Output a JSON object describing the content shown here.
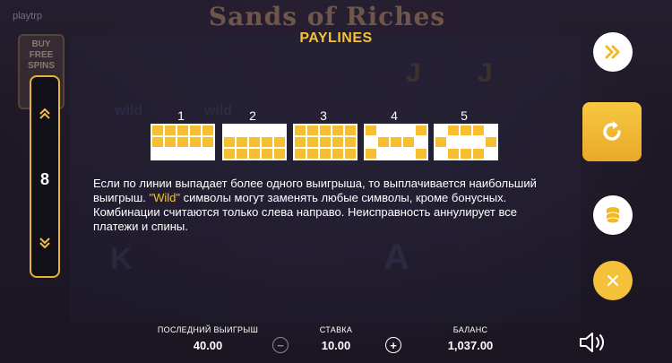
{
  "brand": "playtrp",
  "game_title": "Sands of Riches",
  "buy_panel": {
    "label": "BUY FREE SPINS"
  },
  "heading": "PAYLINES",
  "paylines": [
    {
      "number": "1",
      "pattern": [
        [
          1,
          1,
          1,
          1,
          1
        ],
        [
          1,
          1,
          1,
          1,
          1
        ],
        [
          0,
          0,
          0,
          0,
          0
        ]
      ]
    },
    {
      "number": "2",
      "pattern": [
        [
          0,
          0,
          0,
          0,
          0
        ],
        [
          1,
          1,
          1,
          1,
          1
        ],
        [
          1,
          1,
          1,
          1,
          1
        ]
      ]
    },
    {
      "number": "3",
      "pattern": [
        [
          1,
          1,
          1,
          1,
          1
        ],
        [
          1,
          1,
          1,
          1,
          1
        ],
        [
          1,
          1,
          1,
          1,
          1
        ]
      ]
    },
    {
      "number": "4",
      "pattern": [
        [
          1,
          0,
          0,
          0,
          1
        ],
        [
          0,
          1,
          1,
          1,
          0
        ],
        [
          1,
          0,
          0,
          0,
          1
        ]
      ]
    },
    {
      "number": "5",
      "pattern": [
        [
          0,
          1,
          1,
          1,
          0
        ],
        [
          1,
          0,
          0,
          0,
          1
        ],
        [
          0,
          1,
          1,
          1,
          0
        ]
      ]
    }
  ],
  "rules": {
    "part1": "Если по линии выпадает более одного выигрыша, то выплачивается наибольший выигрыш. ",
    "wild": "\"Wild\"",
    "part2": " символы могут заменять любые символы, кроме бонусных. Комбинации считаются только слева направо. Неисправность аннулирует все платежи и спины."
  },
  "bet_panel": {
    "value": "8",
    "up_icon": "double-chevron-up-icon",
    "down_icon": "double-chevron-down-icon"
  },
  "right_buttons": {
    "fast_forward": "fast-forward-icon",
    "spin": "replay-icon",
    "coins": "coins-icon",
    "close": "close-icon"
  },
  "bottom": {
    "last_win_label": "ПОСЛЕДНИЙ ВЫИГРЫШ",
    "last_win_value": "40.00",
    "bet_label": "СТАВКА",
    "bet_value": "10.00",
    "balance_label": "БАЛАНС",
    "balance_value": "1,037.00",
    "minus": "−",
    "plus": "+"
  },
  "colors": {
    "accent": "#f5c13a",
    "cell_on": "#f7be32",
    "text": "#ffffff"
  }
}
